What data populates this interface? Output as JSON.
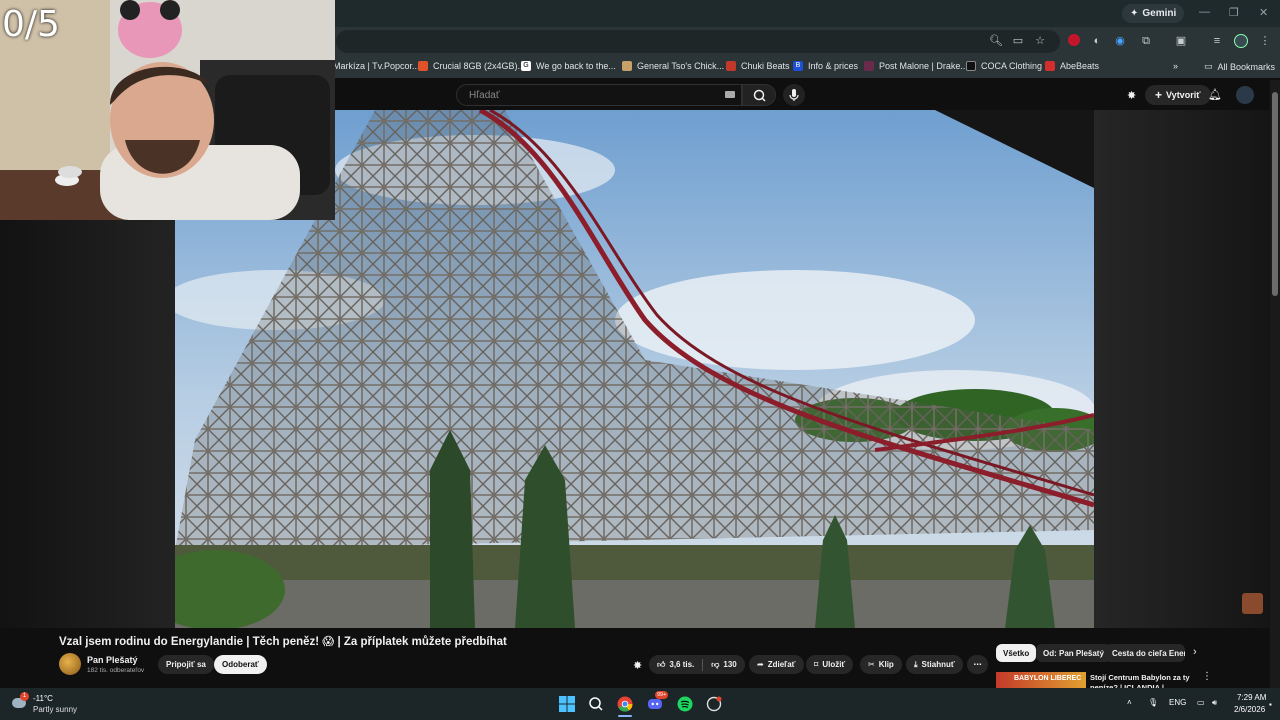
{
  "browser": {
    "gemini_label": "Gemini",
    "bookmarks": [
      {
        "label": "Markíza | Tv.Popcor...",
        "color": "#2a2a2a"
      },
      {
        "label": "Crucial 8GB (2x4GB)...",
        "color": "#e0522a"
      },
      {
        "label": "We go back to the...",
        "color": "#4a4a4a"
      },
      {
        "label": "General Tso's Chick...",
        "color": "#c8a06a"
      },
      {
        "label": "Chuki Beats",
        "color": "#c0392b"
      },
      {
        "label": "Info & prices",
        "color": "#1e4fd8"
      },
      {
        "label": "Post Malone | Drake...",
        "color": "#6a2a4a"
      },
      {
        "label": "COCA Clothing",
        "color": "#111111"
      },
      {
        "label": "AbeBeats",
        "color": "#d32f2f"
      }
    ],
    "all_bookmarks_label": "All Bookmarks"
  },
  "youtube": {
    "search_placeholder": "Hľadať",
    "create_label": "Vytvoriť",
    "video": {
      "title": "Vzal jsem rodinu do Energylandie | Těch peněz! 😱 | Za příplatek můžete předbíhat",
      "channel_name": "Pan Plešatý",
      "channel_subs": "182 tis. odberateľov",
      "join_label": "Pripojiť sa",
      "subscribe_label": "Odoberať",
      "likes": "3,6 tis.",
      "dislikes": "130",
      "share_label": "Zdieľať",
      "save_label": "Uložiť",
      "clip_label": "Klip",
      "download_label": "Stiahnuť"
    },
    "chips": [
      "Všetko",
      "Od: Pan Plešatý",
      "Cesta do cieľa Energ"
    ],
    "recommendation": {
      "thumb_text": "BABYLON LIBEREC",
      "title": "Stojí Centrum Babylon za ty peníze? | ICLANDIA | Aquapar"
    }
  },
  "overlay": {
    "counter": "0/5"
  },
  "taskbar": {
    "weather_badge": "1",
    "temperature": "-11°C",
    "weather": "Partly sunny",
    "discord_badge": "99+",
    "language": "ENG",
    "time": "7:29 AM",
    "date": "2/6/2026"
  },
  "colors": {
    "youtube_bg": "#0f0f0f",
    "chrome_toolbar": "#2b3538",
    "taskbar": "#1c2528",
    "track_red": "#8b1e2a"
  }
}
